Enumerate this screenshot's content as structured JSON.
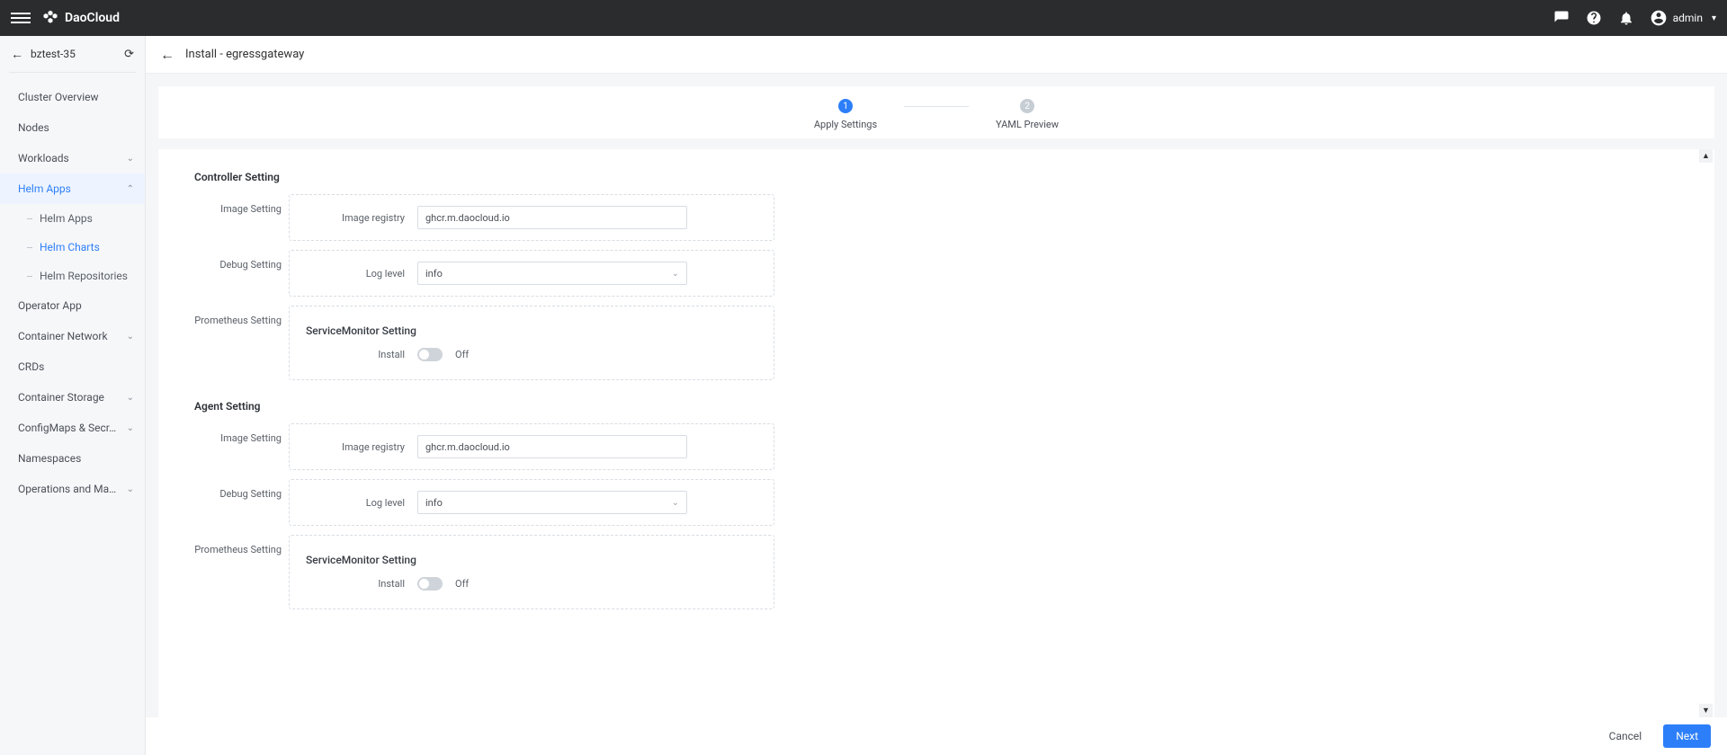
{
  "topbar": {
    "brand": "DaoCloud",
    "user": "admin"
  },
  "context": {
    "name": "bztest-35"
  },
  "sidebar": {
    "items": [
      {
        "label": "Cluster Overview"
      },
      {
        "label": "Nodes"
      },
      {
        "label": "Workloads",
        "expand": true
      },
      {
        "label": "Helm Apps",
        "expand": true,
        "active": true
      },
      {
        "label": "Operator App"
      },
      {
        "label": "Container Network",
        "expand": true
      },
      {
        "label": "CRDs"
      },
      {
        "label": "Container Storage",
        "expand": true
      },
      {
        "label": "ConfigMaps & Secr…",
        "expand": true
      },
      {
        "label": "Namespaces"
      },
      {
        "label": "Operations and Ma…",
        "expand": true
      }
    ],
    "helm_sub": [
      {
        "label": "Helm Apps"
      },
      {
        "label": "Helm Charts",
        "active": true
      },
      {
        "label": "Helm Repositories"
      }
    ]
  },
  "page": {
    "title": "Install - egressgateway"
  },
  "stepper": {
    "step1": {
      "num": "1",
      "label": "Apply Settings"
    },
    "step2": {
      "num": "2",
      "label": "YAML Preview"
    }
  },
  "form": {
    "controller": {
      "title": "Controller Setting",
      "image": {
        "row": "Image Setting",
        "label": "Image registry",
        "value": "ghcr.m.daocloud.io"
      },
      "debug": {
        "row": "Debug Setting",
        "label": "Log level",
        "value": "info"
      },
      "prom": {
        "row": "Prometheus Setting",
        "subtitle": "ServiceMonitor Setting",
        "install_label": "Install",
        "state": "Off"
      }
    },
    "agent": {
      "title": "Agent Setting",
      "image": {
        "row": "Image Setting",
        "label": "Image registry",
        "value": "ghcr.m.daocloud.io"
      },
      "debug": {
        "row": "Debug Setting",
        "label": "Log level",
        "value": "info"
      },
      "prom": {
        "row": "Prometheus Setting",
        "subtitle": "ServiceMonitor Setting",
        "install_label": "Install",
        "state": "Off"
      }
    }
  },
  "footer": {
    "cancel": "Cancel",
    "next": "Next"
  }
}
